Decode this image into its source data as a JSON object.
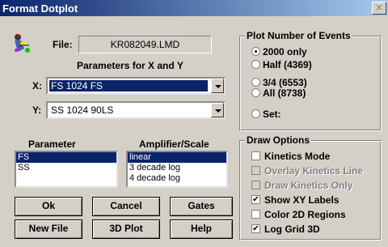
{
  "window": {
    "title": "Format Dotplot",
    "close_glyph": "×"
  },
  "file": {
    "label": "File:",
    "value": "KR082049.LMD"
  },
  "params_heading": "Parameters for X and Y",
  "x": {
    "label": "X:",
    "value": "FS 1024 FS"
  },
  "y": {
    "label": "Y:",
    "value": "SS 1024 90LS"
  },
  "parameter_list": {
    "header": "Parameter",
    "items": [
      "FS",
      "SS"
    ],
    "selected": "FS"
  },
  "amplifier_list": {
    "header": "Amplifier/Scale",
    "items": [
      "linear",
      "3 decade log",
      "4 decade log"
    ],
    "selected": "linear"
  },
  "buttons": {
    "ok": "Ok",
    "cancel": "Cancel",
    "gates": "Gates",
    "new_file": "New File",
    "plot3d": "3D Plot",
    "help": "Help"
  },
  "plot_events": {
    "title": "Plot Number of Events",
    "options": [
      "2000 only",
      "Half (4369)",
      "3/4 (6553)",
      "All (8738)",
      "Set:"
    ],
    "selected": "2000 only"
  },
  "draw_options": {
    "title": "Draw Options",
    "items": [
      {
        "label": "Kinetics Mode",
        "checked": false,
        "enabled": true
      },
      {
        "label": "Overlay Kinetics Line",
        "checked": false,
        "enabled": false
      },
      {
        "label": "Draw Kinetics Only",
        "checked": false,
        "enabled": false
      },
      {
        "label": "Show XY Labels",
        "checked": true,
        "enabled": true
      },
      {
        "label": "Color 2D Regions",
        "checked": false,
        "enabled": true
      },
      {
        "label": "Log Grid 3D",
        "checked": true,
        "enabled": true
      }
    ]
  },
  "icons": {
    "app": "dotplot-app-icon",
    "close": "close-icon",
    "dropdown": "chevron-down-icon"
  },
  "colors": {
    "titlebar_start": "#0a246a",
    "titlebar_end": "#a6caf0",
    "face": "#d4d0c8",
    "selection": "#0a246a"
  }
}
